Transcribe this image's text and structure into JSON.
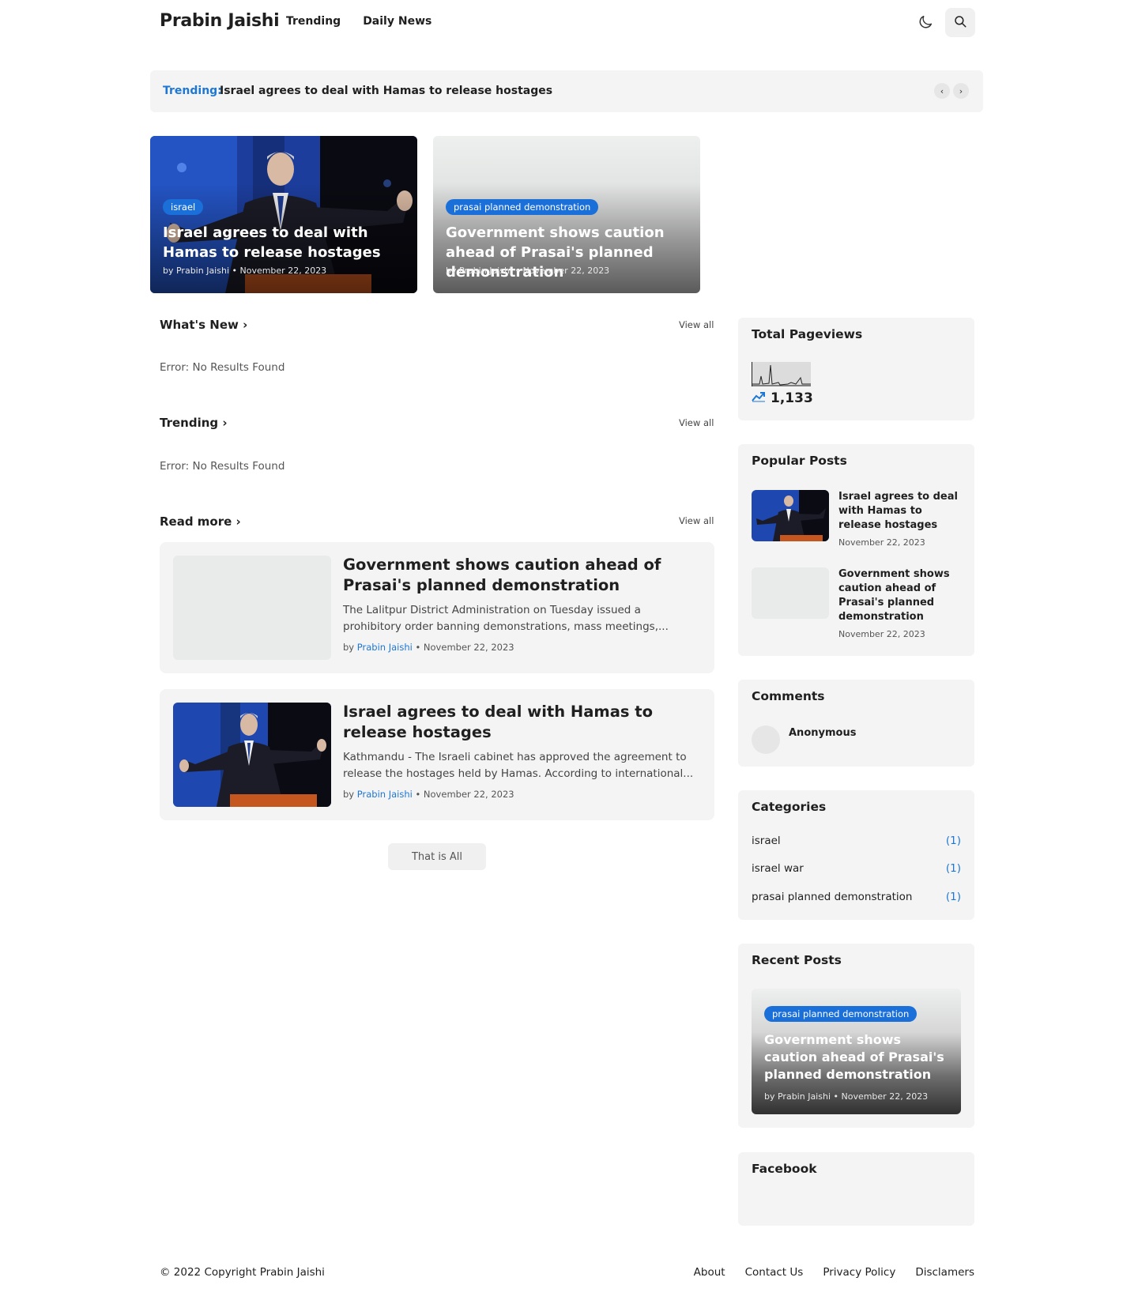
{
  "header": {
    "logo": "Prabin Jaishi",
    "nav": [
      "Trending",
      "Daily News"
    ],
    "icons": [
      "moon-icon",
      "search-icon"
    ]
  },
  "ticker": {
    "label": "Trending:",
    "text": "Israel agrees to deal with Hamas to release hostages",
    "icons": [
      "chevron-left-icon",
      "chevron-right-icon"
    ]
  },
  "featured": [
    {
      "tag": "israel",
      "title": "Israel agrees to deal with Hamas to release hostages",
      "meta": "by Prabin Jaishi • November 22, 2023"
    },
    {
      "tag": "prasai planned demonstration",
      "title": "Government shows caution ahead of Prasai's planned demonstration",
      "meta": "by Prabin Jaishi • November 22, 2023"
    }
  ],
  "sections": {
    "whats_new": {
      "title": "What's New",
      "view_all": "View all",
      "error": "Error: No Results Found"
    },
    "trending": {
      "title": "Trending",
      "view_all": "View all",
      "error": "Error: No Results Found"
    },
    "read_more": {
      "title": "Read more",
      "view_all": "View all"
    }
  },
  "read_more_posts": [
    {
      "title": "Government shows caution ahead of Prasai's planned demonstration",
      "snippet": "The Lalitpur District Administration on Tuesday issued a prohibitory order banning demonstrations, mass meetings,...",
      "by": "by",
      "author": "Prabin Jaishi",
      "date": "• November 22, 2023"
    },
    {
      "title": "Israel agrees to deal with Hamas to release hostages",
      "snippet": "Kathmandu - The Israeli cabinet has approved the agreement to release the hostages held by Hamas. According to international...",
      "by": "by",
      "author": "Prabin Jaishi",
      "date": "• November 22, 2023"
    }
  ],
  "that_is_all": "That is All",
  "sidebar": {
    "pageviews": {
      "title": "Total Pageviews",
      "count": "1,133"
    },
    "popular": {
      "title": "Popular Posts",
      "items": [
        {
          "title": "Israel agrees to deal with Hamas to release hostages",
          "date": "November 22, 2023"
        },
        {
          "title": "Government shows caution ahead of Prasai's planned demonstration",
          "date": "November 22, 2023"
        }
      ]
    },
    "comments": {
      "title": "Comments",
      "name": "Anonymous"
    },
    "categories": {
      "title": "Categories",
      "items": [
        {
          "name": "israel",
          "count": "(1)"
        },
        {
          "name": "israel war",
          "count": "(1)"
        },
        {
          "name": "prasai planned demonstration",
          "count": "(1)"
        }
      ]
    },
    "recent": {
      "title": "Recent Posts",
      "tag": "prasai planned demonstration",
      "post_title": "Government shows caution ahead of Prasai's planned demonstration",
      "meta": "by Prabin Jaishi • November 22, 2023"
    },
    "facebook": {
      "title": "Facebook"
    }
  },
  "footer": {
    "copyright": "© 2022 Copyright Prabin Jaishi",
    "links": [
      "About",
      "Contact Us",
      "Privacy Policy",
      "Disclamers"
    ]
  },
  "colors": {
    "accent": "#1e77d3",
    "tag_bg": "#1b6fd8",
    "widget_bg": "#f4f4f4"
  }
}
